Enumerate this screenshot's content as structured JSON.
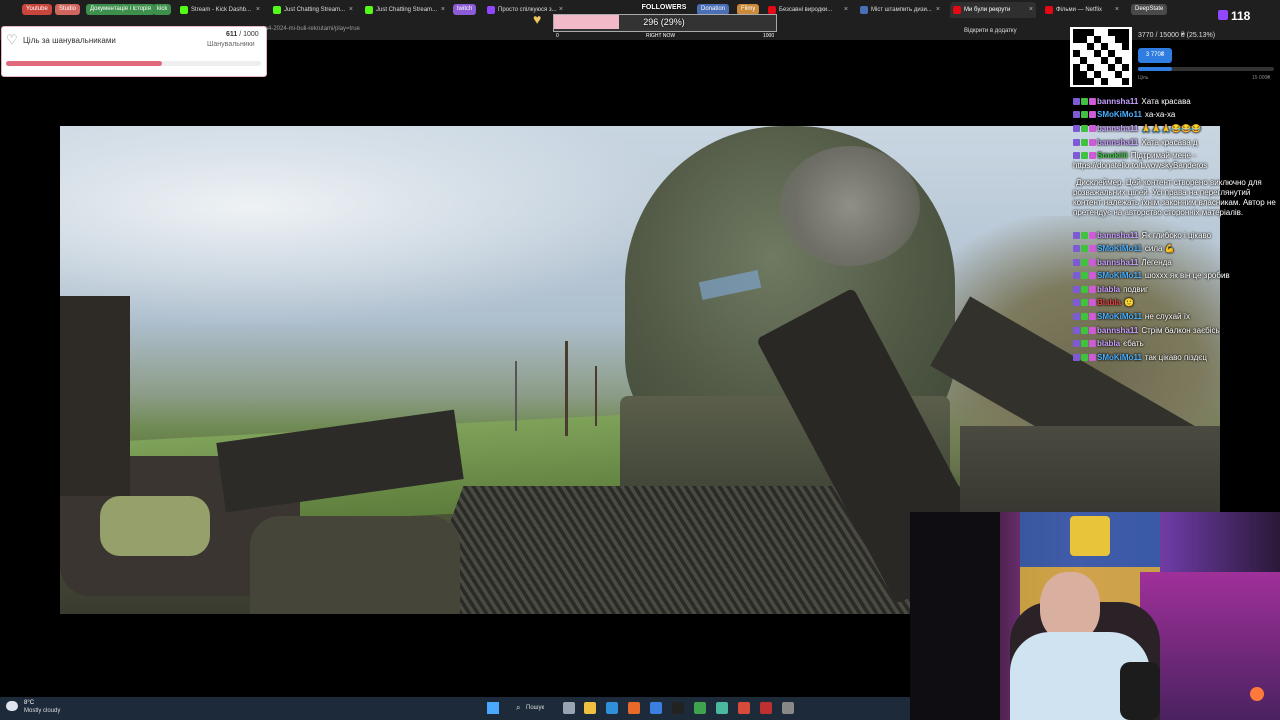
{
  "browser": {
    "bookmarks": [
      {
        "label": "Youtube",
        "color": "#c9463d"
      },
      {
        "label": "Studio",
        "color": "#d0665d"
      },
      {
        "label": "Документація і історія",
        "color": "#3d8f4c"
      },
      {
        "label": "kick",
        "color": "#3d8f4c"
      },
      {
        "label": "twitch",
        "color": "#8c5bd6"
      },
      {
        "label": "Donation",
        "color": "#4a6fb5"
      },
      {
        "label": "Filmy",
        "color": "#c98a3a"
      },
      {
        "label": "DeepState",
        "color": "#4a4a4a"
      }
    ],
    "tabs": [
      {
        "label": "Stream - Kick Dashb...",
        "fav": "#53fc18"
      },
      {
        "label": "Just Chatting Stream...",
        "fav": "#53fc18"
      },
      {
        "label": "Just Chatting Stream...",
        "fav": "#53fc18"
      },
      {
        "label": "Просто спілкуюся з...",
        "fav": "#9146ff"
      },
      {
        "label": "Twitch",
        "fav": "#9146ff"
      },
      {
        "label": "Безсавні виродки...",
        "fav": "#e50914"
      },
      {
        "label": "Міст штампить дизи...",
        "fav": "#4a6fb5"
      },
      {
        "label": "Ми були рекрути",
        "fav": "#e50914"
      },
      {
        "label": "Фільми — Netflix",
        "fav": "#e50914"
      }
    ],
    "url": "...ta4-2024-mi-buli-rekrutami/play=true",
    "open_in_app": "Відкрити в додатку"
  },
  "followers_goal": {
    "title": "FOLLOWERS",
    "value": "296 (29%)",
    "progress": 0.296,
    "min": "0",
    "label": "RIGHT NOW",
    "max": "1000"
  },
  "supporters_goal": {
    "title": "Ціль за шанувальниками",
    "current": "611",
    "sep": " / 1000",
    "unit": "Шанувальники",
    "progress": 0.611
  },
  "donation": {
    "progress_text": "3770 / 15000 ₴ (25.13%)",
    "button": "3 770₴",
    "left": "Ціль",
    "right": "15 000₴",
    "progress": 0.2513
  },
  "viewers": "118",
  "chat": [
    {
      "nick": "bannsha11",
      "msg": "Хата красава",
      "color": "#c9a0ff"
    },
    {
      "nick": "SMoKiMo11",
      "msg": "ха-ха-ха",
      "color": "#4ab0ff"
    },
    {
      "nick": "bannsha11",
      "msg": "🙏🙏🙏😂😂😂",
      "color": "#c9a0ff"
    },
    {
      "nick": "bannsha11",
      "msg": "Хата красава д",
      "color": "#c9a0ff"
    },
    {
      "nick": "Smokiiii",
      "msg": "Підтримай мене - https://donatello.to/LwowskyBanderos",
      "color": "#3fc23f"
    },
    {
      "nick": "",
      "msg": "Дисклеймер. Цей контент створено виключно для розважальних цілей. Усі права на переглянутий контент належать їхнім законним власникам. Автор не претендує на авторство сторонніх матеріалів.",
      "color": "#ffffff"
    },
    {
      "nick": "bannsha11",
      "msg": "Як глибоко і цікаво",
      "color": "#c9a0ff"
    },
    {
      "nick": "SMoKiMo11",
      "msg": "сила 💪",
      "color": "#4ab0ff"
    },
    {
      "nick": "bannsha11",
      "msg": "Легенда",
      "color": "#c9a0ff"
    },
    {
      "nick": "SMoKiMo11",
      "msg": "шоххх як він це зробив",
      "color": "#4ab0ff"
    },
    {
      "nick": "blabla",
      "msg": "подвиг",
      "color": "#c9a0ff"
    },
    {
      "nick": "Blabla",
      "msg": "🙂",
      "color": "#e04040"
    },
    {
      "nick": "SMoKiMo11",
      "msg": "не слухай їх",
      "color": "#4ab0ff"
    },
    {
      "nick": "bannsha11",
      "msg": "Стрім балкон заєбісь",
      "color": "#c9a0ff"
    },
    {
      "nick": "blabla",
      "msg": "єбать",
      "color": "#c9a0ff"
    },
    {
      "nick": "SMoKiMo11",
      "msg": "так цікаво піздєц",
      "color": "#4ab0ff"
    }
  ],
  "taskbar": {
    "weather_temp": "8°C",
    "weather_desc": "Mostly cloudy",
    "search": "Пошук"
  }
}
